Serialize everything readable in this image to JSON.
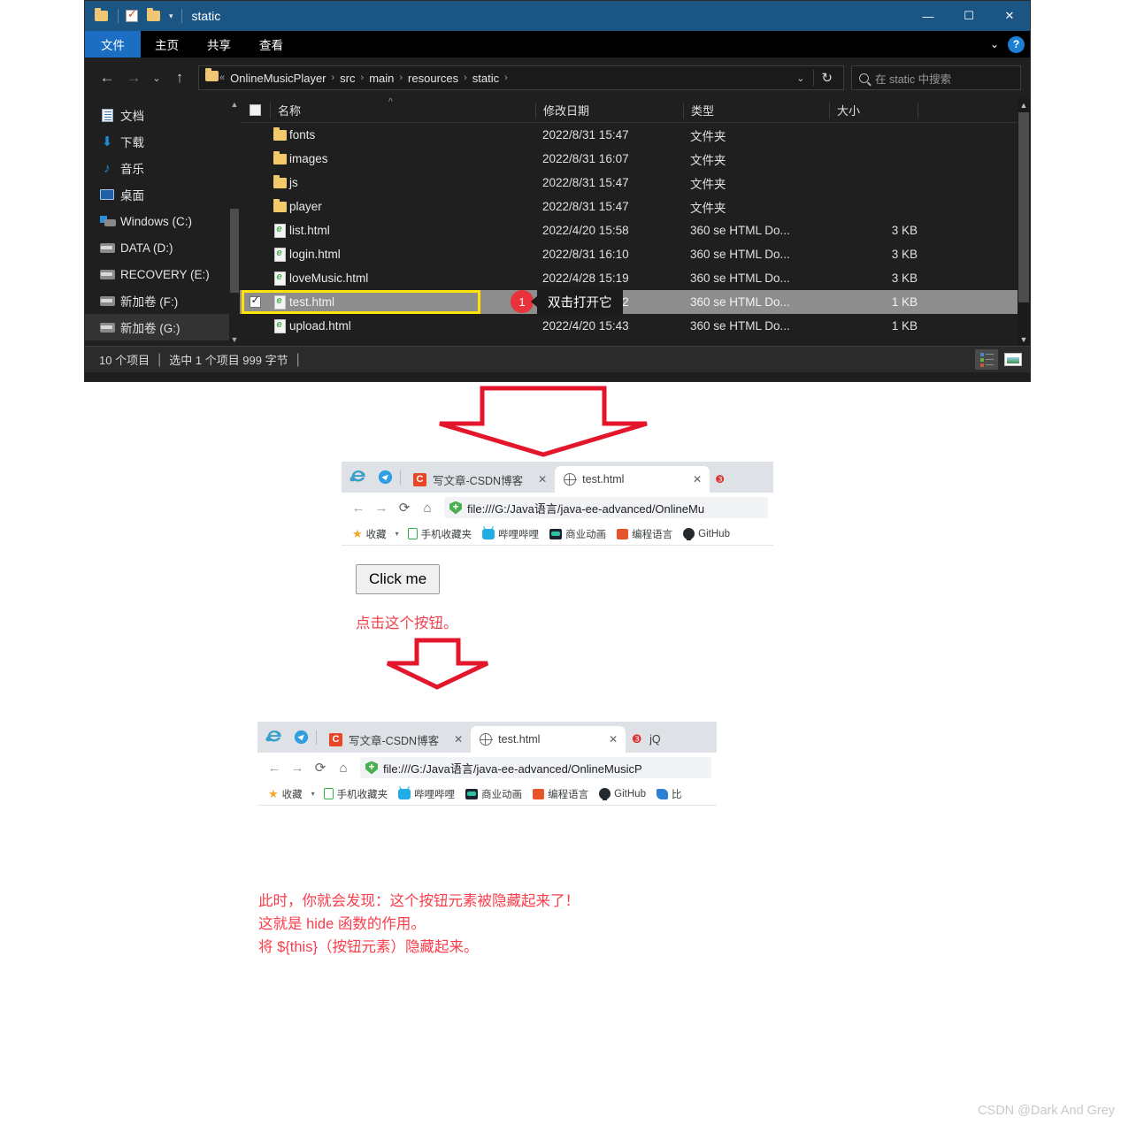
{
  "explorer": {
    "title": "static",
    "quick_access_icons": [
      "folder-icon",
      "checkbox-properties-icon",
      "new-folder-icon",
      "dropdown-caret-icon"
    ],
    "window_buttons": {
      "minimize": "—",
      "maximize": "☐",
      "close": "✕"
    },
    "ribbon_tabs": [
      {
        "label": "文件",
        "active": true
      },
      {
        "label": "主页",
        "active": false
      },
      {
        "label": "共享",
        "active": false
      },
      {
        "label": "查看",
        "active": false
      }
    ],
    "ribbon_help": "?",
    "address": {
      "crumbs": [
        "OnlineMusicPlayer",
        "src",
        "main",
        "resources",
        "static"
      ],
      "leading_sep": "«",
      "separator": "›"
    },
    "search": {
      "placeholder": "在 static 中搜索"
    },
    "nav_items": [
      {
        "label": "文档",
        "icon": "documents-icon",
        "selected": false
      },
      {
        "label": "下载",
        "icon": "downloads-icon",
        "selected": false
      },
      {
        "label": "音乐",
        "icon": "music-icon",
        "selected": false
      },
      {
        "label": "桌面",
        "icon": "desktop-icon",
        "selected": false
      },
      {
        "label": "Windows (C:)",
        "icon": "windows-drive-icon",
        "selected": false
      },
      {
        "label": "DATA (D:)",
        "icon": "drive-icon",
        "selected": false
      },
      {
        "label": "RECOVERY (E:)",
        "icon": "drive-icon",
        "selected": false
      },
      {
        "label": "新加卷 (F:)",
        "icon": "drive-icon",
        "selected": false
      },
      {
        "label": "新加卷 (G:)",
        "icon": "drive-icon",
        "selected": true
      }
    ],
    "columns": [
      "名称",
      "修改日期",
      "类型",
      "大小"
    ],
    "files": [
      {
        "name": "fonts",
        "date": "2022/8/31 15:47",
        "type": "文件夹",
        "size": "",
        "icon": "folder-icon",
        "selected": false,
        "checked": false
      },
      {
        "name": "images",
        "date": "2022/8/31 16:07",
        "type": "文件夹",
        "size": "",
        "icon": "folder-icon",
        "selected": false,
        "checked": false
      },
      {
        "name": "js",
        "date": "2022/8/31 15:47",
        "type": "文件夹",
        "size": "",
        "icon": "folder-icon",
        "selected": false,
        "checked": false
      },
      {
        "name": "player",
        "date": "2022/8/31 15:47",
        "type": "文件夹",
        "size": "",
        "icon": "folder-icon",
        "selected": false,
        "checked": false
      },
      {
        "name": "list.html",
        "date": "2022/4/20 15:58",
        "type": "360 se HTML Do...",
        "size": "3 KB",
        "icon": "html-file-icon",
        "selected": false,
        "checked": false
      },
      {
        "name": "login.html",
        "date": "2022/8/31 16:10",
        "type": "360 se HTML Do...",
        "size": "3 KB",
        "icon": "html-file-icon",
        "selected": false,
        "checked": false
      },
      {
        "name": "loveMusic.html",
        "date": "2022/4/28 15:19",
        "type": "360 se HTML Do...",
        "size": "3 KB",
        "icon": "html-file-icon",
        "selected": false,
        "checked": false
      },
      {
        "name": "test.html",
        "date": "2022/8/31 17:12",
        "type": "360 se HTML Do...",
        "size": "1 KB",
        "icon": "html-file-icon",
        "selected": true,
        "checked": true
      },
      {
        "name": "upload.html",
        "date": "2022/4/20 15:43",
        "type": "360 se HTML Do...",
        "size": "1 KB",
        "icon": "html-file-icon",
        "selected": false,
        "checked": false
      }
    ],
    "annotation": {
      "badge": "1",
      "callout": "双击打开它",
      "highlight_color": "#ffe400",
      "badge_color": "#e8323c"
    },
    "status": {
      "count": "10 个项目",
      "selection": "选中 1 个项目  999 字节",
      "sep": "|"
    }
  },
  "browser1": {
    "tabs": [
      {
        "label": "写文章-CSDN博客",
        "icon": "csdn-icon",
        "active": false,
        "close": "✕"
      },
      {
        "label": "test.html",
        "icon": "globe-icon",
        "active": true,
        "close": "✕"
      }
    ],
    "ie_icon": "ie-logo-icon",
    "telegram_icon": "telegram-logo-icon",
    "url": "file:///G:/Java语言/java-ee-advanced/OnlineMu",
    "bookmarks": [
      {
        "label": "收藏",
        "icon": "star-icon"
      },
      {
        "label": "手机收藏夹",
        "icon": "phone-icon"
      },
      {
        "label": "哔哩哔哩",
        "icon": "bilibili-icon"
      },
      {
        "label": "商业动画",
        "icon": "business-icon"
      },
      {
        "label": "编程语言",
        "icon": "code-icon"
      },
      {
        "label": "GitHub",
        "icon": "github-icon"
      }
    ],
    "page": {
      "button_label": "Click me",
      "note": "点击这个按钮。"
    }
  },
  "browser2": {
    "tabs": [
      {
        "label": "写文章-CSDN博客",
        "icon": "csdn-icon",
        "active": false,
        "close": "✕"
      },
      {
        "label": "test.html",
        "icon": "globe-icon",
        "active": true,
        "close": "✕"
      },
      {
        "label": "jQ",
        "icon": "jquery-icon",
        "active": false,
        "close": ""
      }
    ],
    "ie_icon": "ie-logo-icon",
    "telegram_icon": "telegram-logo-icon",
    "url": "file:///G:/Java语言/java-ee-advanced/OnlineMusicP",
    "bookmarks": [
      {
        "label": "收藏",
        "icon": "star-icon"
      },
      {
        "label": "手机收藏夹",
        "icon": "phone-icon"
      },
      {
        "label": "哔哩哔哩",
        "icon": "bilibili-icon"
      },
      {
        "label": "商业动画",
        "icon": "business-icon"
      },
      {
        "label": "编程语言",
        "icon": "code-icon"
      },
      {
        "label": "GitHub",
        "icon": "github-icon"
      },
      {
        "label": "比",
        "icon": "baidu-icon"
      }
    ],
    "page": {
      "content": ""
    }
  },
  "annotations": {
    "bottom_note": "此时，你就会发现：这个按钮元素被隐藏起来了！\n这就是 hide 函数的作用。\n将 ${this}（按钮元素）隐藏起来。",
    "arrow_color": "#e3162b"
  },
  "watermark": "CSDN @Dark And Grey"
}
